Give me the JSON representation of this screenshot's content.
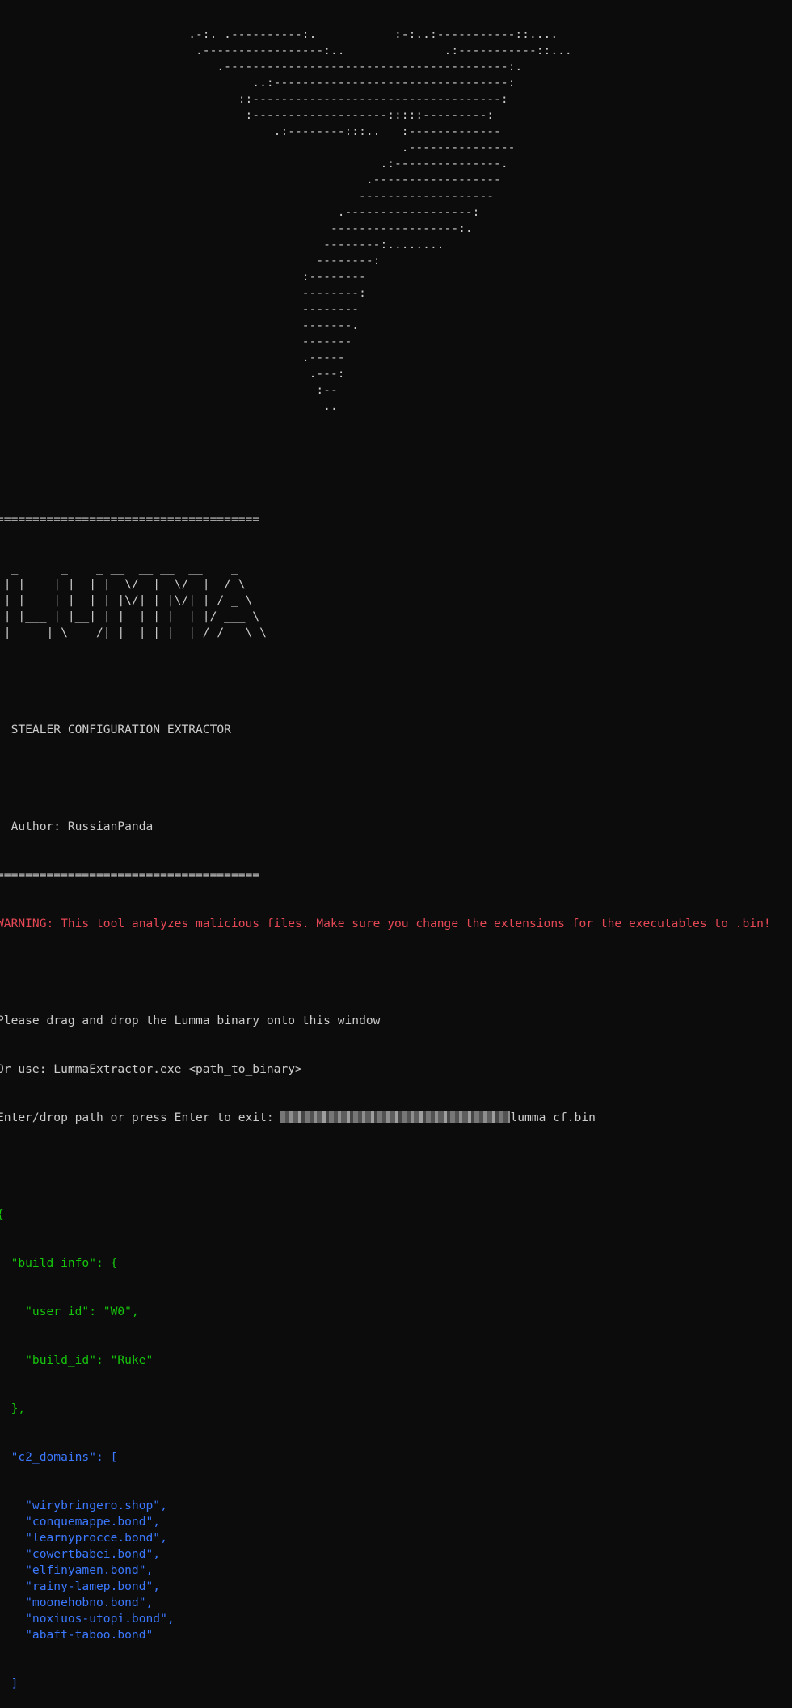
{
  "ascii_logo": [
    "                           .-:. .----------:.           :-:..:-----------::....",
    "                            .-----------------:..              .:-----------::...",
    "                               .----------------------------------------:.",
    "                                    ..:---------------------------------:",
    "                                  ::-----------------------------------:",
    "                                   :-------------------:::::---------:",
    "                                       .:--------:::..   :-------------",
    "                                                         .---------------",
    "                                                      .:---------------.",
    "                                                    .------------------",
    "                                                   -------------------",
    "                                                .------------------:",
    "                                               ------------------:.",
    "                                              --------:........",
    "                                             --------:",
    "                                           :--------",
    "                                           --------:",
    "                                           --------",
    "                                           -------.",
    "                                           -------",
    "                                           .-----",
    "                                            .---:",
    "                                             :--",
    "                                              .."
  ],
  "blank_lines_after_logo": 2,
  "separator": "=====================================",
  "banner_lines": [
    "  _      _    _ __  __ __  __    _",
    " | |    | |  | |  \\/  |  \\/  |  / \\",
    " | |    | |  | | |\\/| | |\\/| | / _ \\",
    " | |___ | |__| | |  | | |  | |/ ___ \\",
    " |_____| \\____/|_|  |_|_|  |_/_/   \\_\\"
  ],
  "subtitle": "  STEALER CONFIGURATION EXTRACTOR",
  "author": "  Author: RussianPanda",
  "warning": "WARNING: This tool analyzes malicious files. Make sure you change the extensions for the executables to .bin!",
  "instructions": [
    "Please drag and drop the Lumma binary onto this window",
    "Or use: LummaExtractor.exe <path_to_binary>"
  ],
  "prompt": {
    "label": "Enter/drop path or press Enter to exit: ",
    "filename": "lumma_cf.bin"
  },
  "output": {
    "open_brace": "{",
    "build_info_open": "  \"build info\": {",
    "user_id_line": "    \"user_id\": \"W0\",",
    "build_id_line": "    \"build_id\": \"Ruke\"",
    "build_info_close": "  },",
    "c2_open": "  \"c2_domains\": [",
    "c2_domains": [
      "    \"wirybringero.shop\",",
      "    \"conquemappe.bond\",",
      "    \"learnyprocce.bond\",",
      "    \"cowertbabei.bond\",",
      "    \"elfinyamen.bond\",",
      "    \"rainy-lamep.bond\",",
      "    \"moonehobno.bond\",",
      "    \"noxiuos-utopi.bond\",",
      "    \"abaft-taboo.bond\""
    ],
    "c2_close": "  ]"
  },
  "colors": {
    "background": "#0c0c0c",
    "text": "#cccccc",
    "warning": "#e74856",
    "json_green": "#16c60c",
    "json_blue": "#3b78ff"
  }
}
